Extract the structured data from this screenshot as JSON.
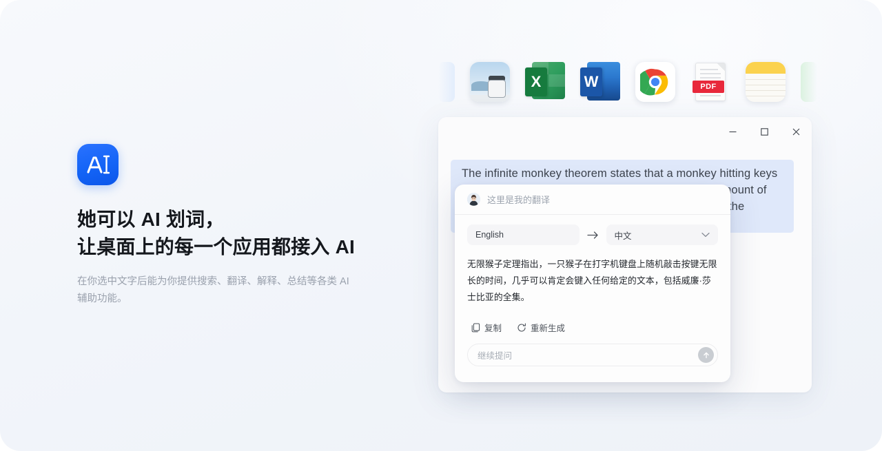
{
  "hero": {
    "logo_icon": "ai-text-cursor-logo",
    "headline": "她可以 AI 划词，\n让桌面上的每一个应用都接入 AI",
    "subtext": "在你选中文字后能为你提供搜索、翻译、解释、总结等各类 AI 辅助功能。"
  },
  "app_dock": {
    "items": [
      {
        "name": "partial-blue-app",
        "icon": "partial-app-icon",
        "label": ""
      },
      {
        "name": "photos",
        "icon": "photos-icon",
        "label": ""
      },
      {
        "name": "excel",
        "icon": "excel-icon",
        "label": "X"
      },
      {
        "name": "word",
        "icon": "word-icon",
        "label": "W"
      },
      {
        "name": "chrome",
        "icon": "chrome-icon",
        "label": ""
      },
      {
        "name": "pdf",
        "icon": "pdf-icon",
        "label": "PDF"
      },
      {
        "name": "notes",
        "icon": "notes-icon",
        "label": ""
      },
      {
        "name": "partial-green-app",
        "icon": "partial-app-icon",
        "label": ""
      }
    ]
  },
  "window": {
    "controls": {
      "minimize": "minimize-icon",
      "maximize": "maximize-icon",
      "close": "close-icon"
    },
    "selected_text": "The infinite monkey theorem states that a monkey hitting keys at random on a typewriter keyboard for an infinite amount of time will almost surely type any given text, including the complete works of William Shakespeare.",
    "selection_color": "#dfe8fa"
  },
  "ai_panel": {
    "header": {
      "avatar_icon": "user-avatar",
      "title": "这里是我的翻译"
    },
    "language": {
      "source": "English",
      "arrow_icon": "arrow-right-icon",
      "target": "中文",
      "chevron_icon": "chevron-down-icon"
    },
    "result": "无限猴子定理指出，一只猴子在打字机键盘上随机敲击按键无限长的时间，几乎可以肯定会键入任何给定的文本，包括威廉·莎士比亚的全集。",
    "actions": [
      {
        "name": "copy",
        "icon": "copy-icon",
        "label": "复制"
      },
      {
        "name": "regenerate",
        "icon": "refresh-icon",
        "label": "重新生成"
      }
    ],
    "ask": {
      "placeholder": "继续提问",
      "value": "",
      "send_icon": "arrow-up-icon"
    }
  },
  "theme": {
    "accent": "#1464f6",
    "selection": "#dfe8fa",
    "page_bg": "#f2f5fa"
  }
}
